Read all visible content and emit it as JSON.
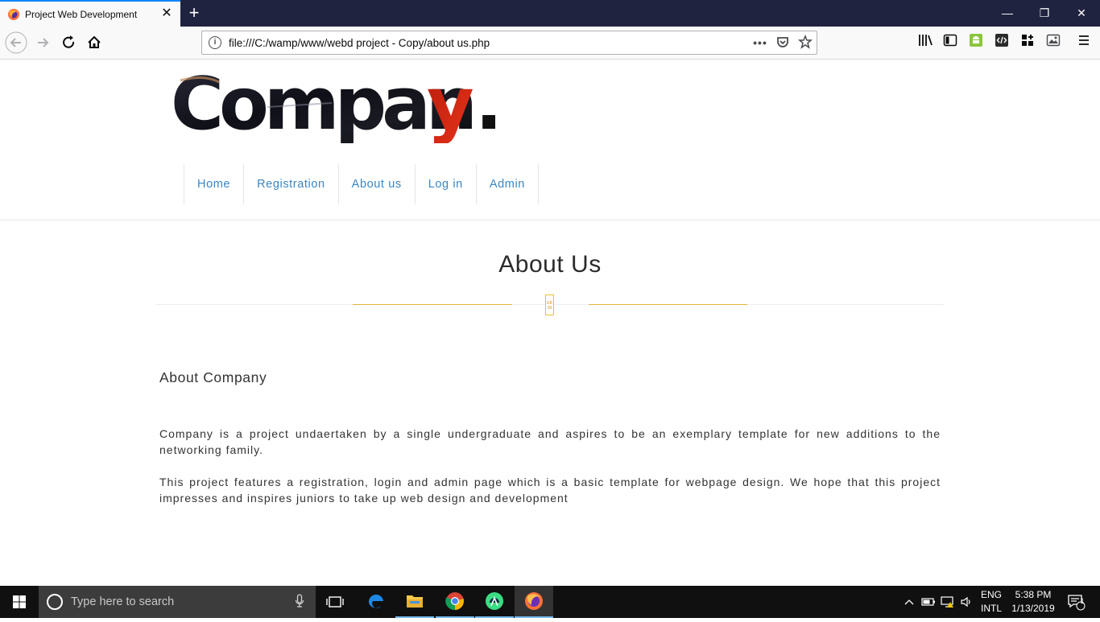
{
  "browser": {
    "tab_title": "Project Web Development",
    "tab_close": "✕",
    "new_tab": "+",
    "url": "file:///C:/wamp/www/webd project - Copy/about us.php"
  },
  "window_controls": {
    "minimize": "—",
    "restore": "❐",
    "close": "✕"
  },
  "site": {
    "logo_text": "Company.",
    "menu": [
      {
        "label": "Home"
      },
      {
        "label": "Registration"
      },
      {
        "label": "About us"
      },
      {
        "label": "Log in"
      },
      {
        "label": "Admin"
      }
    ]
  },
  "content": {
    "title": "About Us",
    "separator_icon_text": "EB 09",
    "section_heading": "About Company",
    "paragraphs": [
      "Company is a project undaertaken by a single undergraduate and aspires to be an exemplary template for new additions to the networking family.",
      "This project features a registration, login and admin page which is a basic template for webpage design. We hope that this project impresses and inspires juniors to take up web design and development"
    ]
  },
  "taskbar": {
    "search_placeholder": "Type here to search",
    "language_line1": "ENG",
    "language_line2": "INTL",
    "time": "5:38 PM",
    "date": "1/13/2019",
    "notification_count": "1"
  },
  "colors": {
    "tab_bar": "#202340",
    "menu_link": "#3a86c4",
    "accent_gold": "#e2b23a",
    "logo_red": "#d42a12",
    "taskbar": "#101010"
  }
}
